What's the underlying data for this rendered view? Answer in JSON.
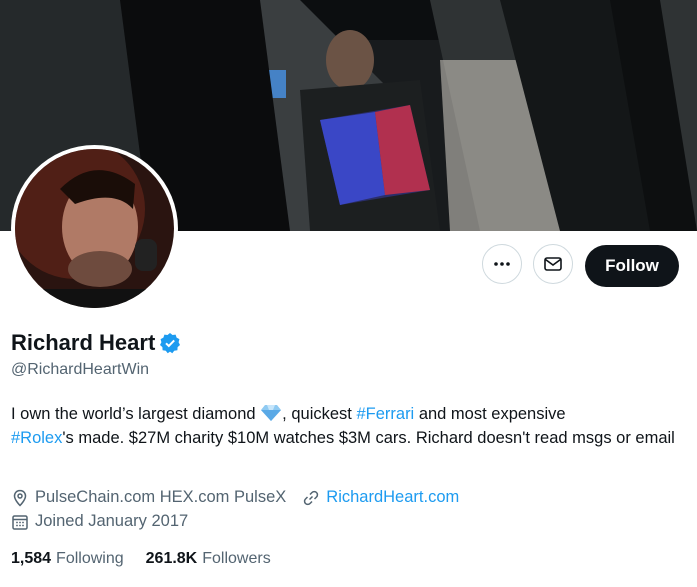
{
  "profile": {
    "name": "Richard Heart",
    "handle": "@RichardHeartWin",
    "bio": {
      "part1": "I own the world’s largest diamond ",
      "part2": ", quickest ",
      "hashtag1": "#Ferrari",
      "part3": " and most expensive ",
      "hashtag2": "#Rolex",
      "part4": "'s made. $27M charity $10M watches $3M cars. Richard doesn't read msgs or email"
    },
    "location": "PulseChain.com HEX.com PulseX",
    "website": "RichardHeart.com",
    "joined": "Joined January 2017",
    "following_count": "1,584",
    "following_label": "Following",
    "followers_count": "261.8K",
    "followers_label": "Followers"
  },
  "actions": {
    "follow_label": "Follow"
  },
  "colors": {
    "accent": "#1d9bf0",
    "follow_bg": "#0f1419",
    "muted": "#536471"
  },
  "icons": [
    "more-icon",
    "mail-icon",
    "verified-icon",
    "diamond-icon",
    "location-icon",
    "link-icon",
    "calendar-icon"
  ]
}
